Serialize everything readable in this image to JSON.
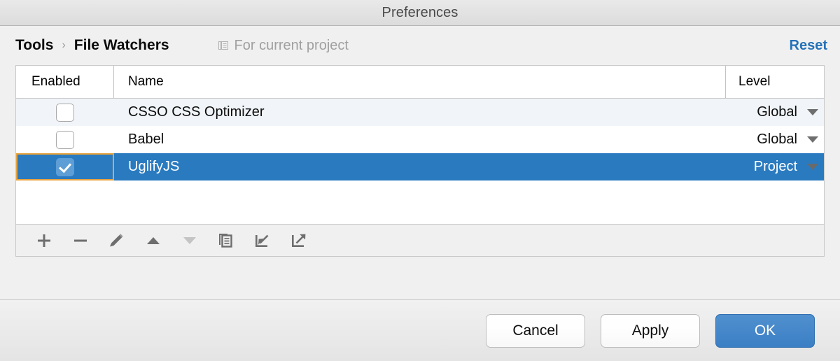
{
  "window": {
    "title": "Preferences"
  },
  "header": {
    "breadcrumb": {
      "parent": "Tools",
      "separator": "›",
      "current": "File Watchers"
    },
    "scope": {
      "icon": "module-document-icon",
      "label": "For current project"
    },
    "reset_label": "Reset",
    "reset_color": "#2471b8"
  },
  "table": {
    "columns": [
      {
        "key": "enabled",
        "label": "Enabled"
      },
      {
        "key": "name",
        "label": "Name"
      },
      {
        "key": "level",
        "label": "Level"
      }
    ],
    "rows": [
      {
        "enabled": false,
        "name": "CSSO CSS Optimizer",
        "level": "Global",
        "selected": false
      },
      {
        "enabled": false,
        "name": "Babel",
        "level": "Global",
        "selected": false
      },
      {
        "enabled": true,
        "name": "UglifyJS",
        "level": "Project",
        "selected": true
      }
    ],
    "selection_color": "#2a7ac0",
    "focus_ring_color": "#e8a33d",
    "stripe_color": "#f1f5f9"
  },
  "toolbar": {
    "buttons": [
      {
        "name": "add-watcher-button",
        "icon": "plus-icon",
        "enabled": true
      },
      {
        "name": "remove-watcher-button",
        "icon": "minus-icon",
        "enabled": true
      },
      {
        "name": "edit-watcher-button",
        "icon": "pencil-icon",
        "enabled": true
      },
      {
        "name": "move-up-button",
        "icon": "arrow-up-icon",
        "enabled": true
      },
      {
        "name": "move-down-button",
        "icon": "arrow-down-icon",
        "enabled": false
      },
      {
        "name": "copy-watcher-button",
        "icon": "copy-icon",
        "enabled": true
      },
      {
        "name": "import-button",
        "icon": "import-arrow-icon",
        "enabled": true
      },
      {
        "name": "export-button",
        "icon": "export-arrow-icon",
        "enabled": true
      }
    ]
  },
  "footer": {
    "cancel_label": "Cancel",
    "apply_label": "Apply",
    "ok_label": "OK",
    "ok_color": "#3b7fc4"
  }
}
